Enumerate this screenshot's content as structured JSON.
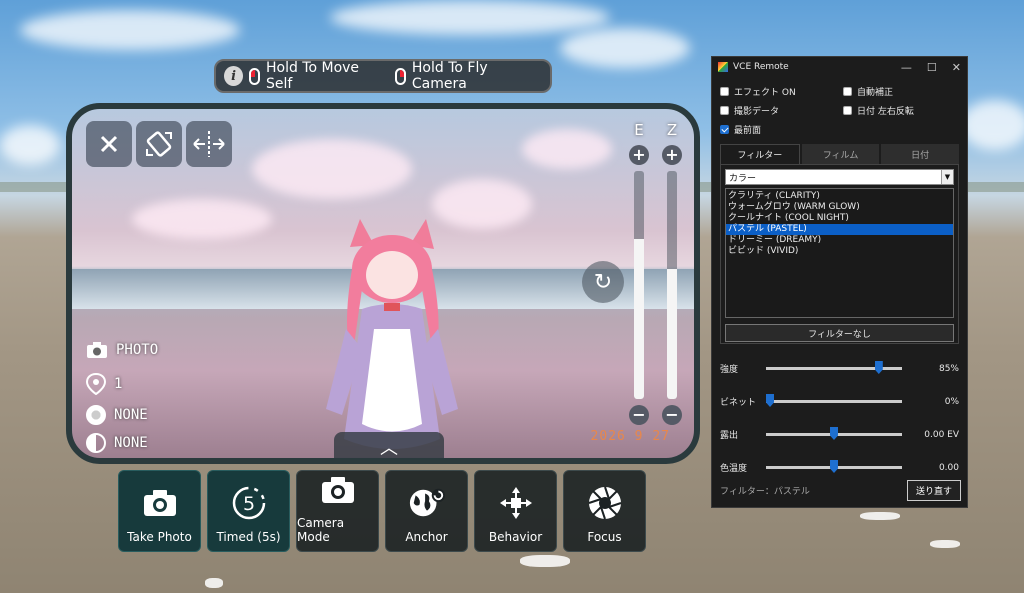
{
  "hint_bar": {
    "left_action": "Hold To Move Self",
    "right_action": "Hold To Fly Camera"
  },
  "viewfinder": {
    "slider_labels": [
      "E",
      "Z"
    ],
    "slider_levels": [
      0.7,
      0.57
    ],
    "mode_label": "PHOTO",
    "count_label": "1",
    "effect_label": "NONE",
    "filter_label": "NONE",
    "date_stamp": "2026 9 27"
  },
  "toolbar": {
    "buttons": [
      {
        "label": "Take Photo",
        "icon": "camera-icon"
      },
      {
        "label": "Timed (5s)",
        "icon": "timer-5-icon"
      },
      {
        "label": "Camera Mode",
        "icon": "camera-icon"
      },
      {
        "label": "Anchor",
        "icon": "globe-reset-icon"
      },
      {
        "label": "Behavior",
        "icon": "move-arrows-icon"
      },
      {
        "label": "Focus",
        "icon": "aperture-icon"
      }
    ]
  },
  "vce": {
    "title": "VCE Remote",
    "checks": [
      {
        "label": "エフェクト ON",
        "checked": false
      },
      {
        "label": "自動補正",
        "checked": false
      },
      {
        "label": "撮影データ",
        "checked": false
      },
      {
        "label": "日付 左右反転",
        "checked": false
      },
      {
        "label": "最前面",
        "checked": true
      }
    ],
    "tabs": [
      "フィルター",
      "フィルム",
      "日付"
    ],
    "combo_value": "カラー",
    "filters": [
      "クラリティ (CLARITY)",
      "ウォームグロウ (WARM GLOW)",
      "クールナイト (COOL NIGHT)",
      "パステル (PASTEL)",
      "ドリーミー (DREAMY)",
      "ビビッド (VIVID)"
    ],
    "selected_filter_index": 3,
    "no_filter_button": "フィルターなし",
    "sliders": [
      {
        "label": "強度",
        "value": "85%",
        "pos": 0.85
      },
      {
        "label": "ビネット",
        "value": "0%",
        "pos": 0.0
      },
      {
        "label": "露出",
        "value": "0.00 EV",
        "pos": 0.5
      },
      {
        "label": "色温度",
        "value": "0.00",
        "pos": 0.5
      }
    ],
    "footer_text": "フィルター：パステル",
    "send_button": "送り直す"
  },
  "colors": {
    "accent": "#1e6fd0",
    "date_stamp": "#e8874b",
    "toolbar_active": "#173a3c"
  }
}
